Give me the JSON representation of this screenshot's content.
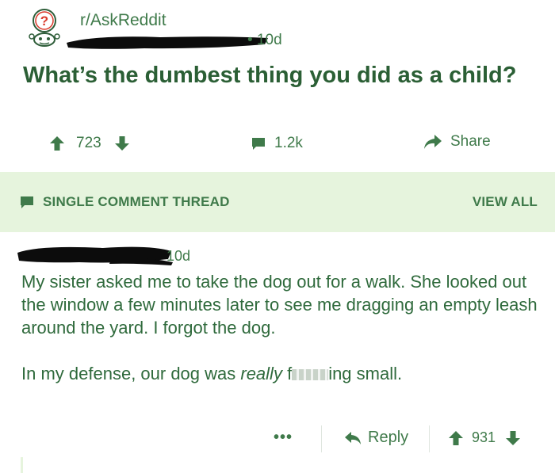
{
  "post": {
    "subreddit": "r/AskReddit",
    "age": "• 10d",
    "title": "What’s the dumbest thing you did as a child?"
  },
  "actions": {
    "votes": "723",
    "comments": "1.2k",
    "share": "Share"
  },
  "thread": {
    "label": "SINGLE COMMENT THREAD",
    "view_all": "VIEW ALL"
  },
  "comment": {
    "age": "10d",
    "paragraph1": "My sister asked me to take the dog out for a walk. She looked out the window a few minutes later to see me dragging an empty leash around the yard. I forgot the dog.",
    "p2_before": "In my defense, our dog was ",
    "p2_emph": "really",
    "p2_f": " f",
    "p2_after": "ing small.",
    "more": "•••",
    "reply": "Reply",
    "votes": "931"
  },
  "colors": {
    "accent": "#3f7a4a",
    "banner_bg": "#e6f4dd",
    "title": "#2b5f35"
  },
  "icons": [
    "subreddit-avatar-icon",
    "upvote-icon",
    "downvote-icon",
    "comment-icon",
    "share-icon",
    "reply-icon"
  ]
}
